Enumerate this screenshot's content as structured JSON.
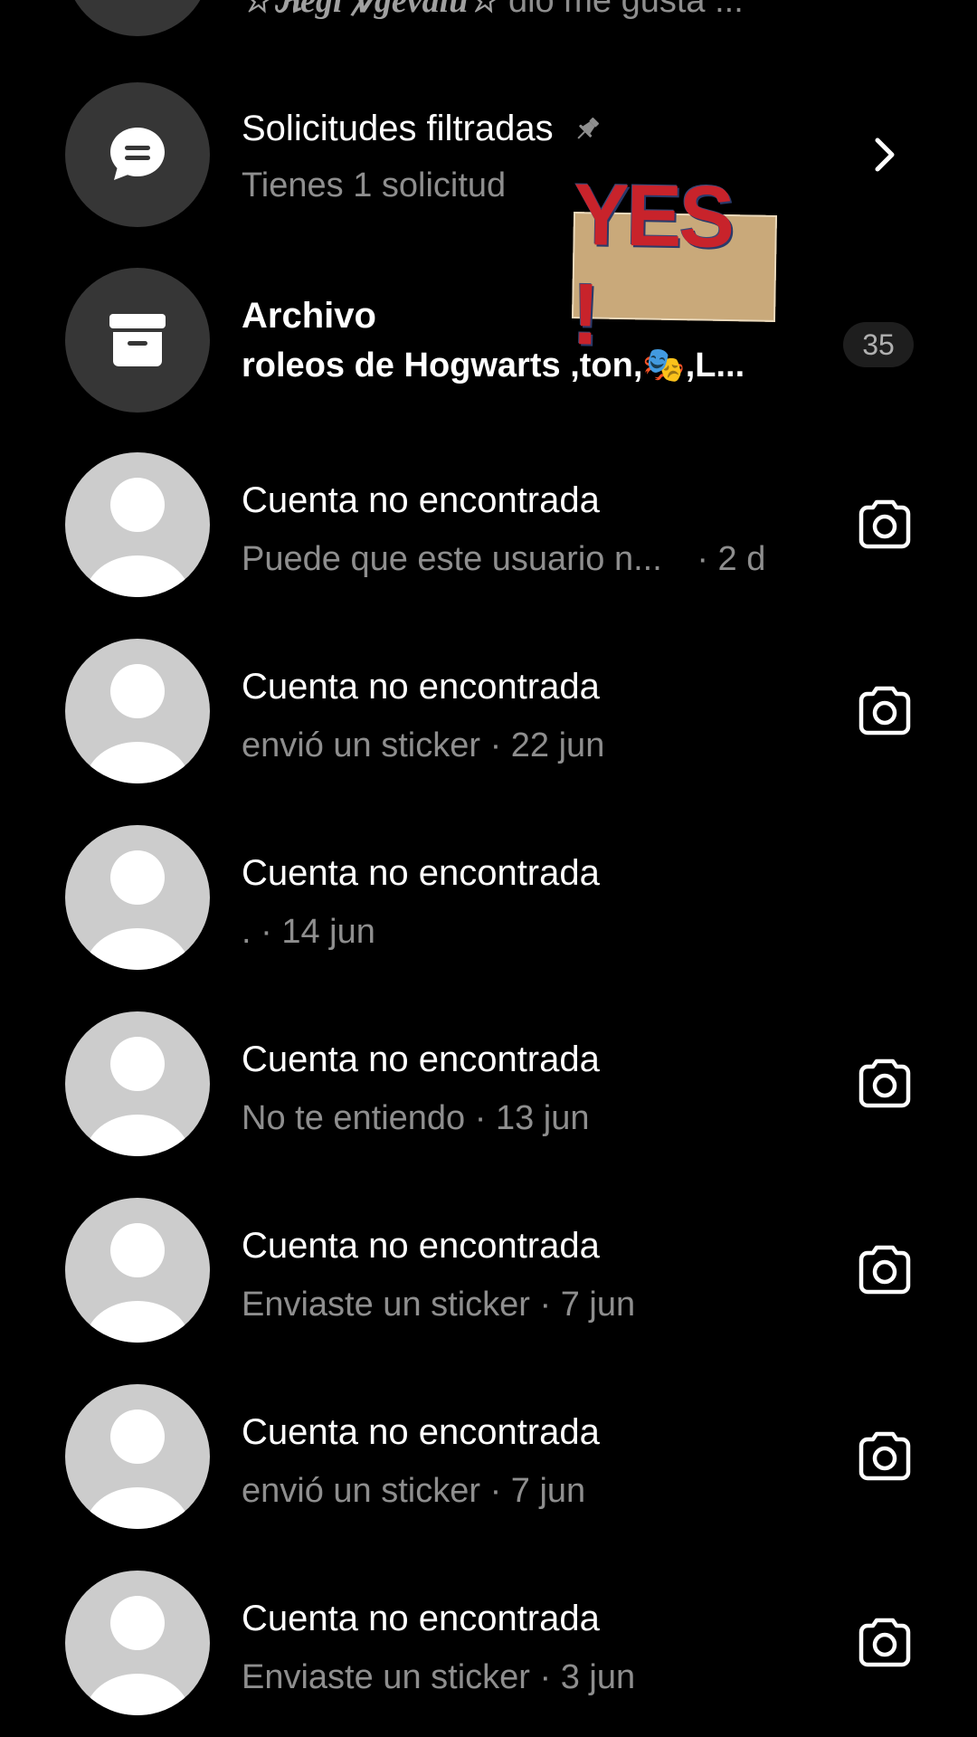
{
  "top_row": {
    "name": "☆ℜegi ℣gevaiu☆",
    "preview": "dio me gusta ..."
  },
  "filtered_requests": {
    "title": "Solicitudes filtradas",
    "subtitle": "Tienes 1 solicitud",
    "icon": "chat-bubble-icon",
    "pin_icon": "pin-icon",
    "chevron_icon": "chevron-right-icon"
  },
  "archive": {
    "title": "Archivo",
    "subtitle": "roleos de Hogwarts ,ton,🎭,L...",
    "badge": "35",
    "icon": "archive-box-icon"
  },
  "sticker": {
    "text": "YES !"
  },
  "conversations": [
    {
      "name": "Cuenta no encontrada",
      "preview": "Puede que este usuario n...",
      "time": "· 2 d",
      "camera": true
    },
    {
      "name": "Cuenta no encontrada",
      "preview": "envió un sticker",
      "time": "· 22 jun",
      "camera": true
    },
    {
      "name": "Cuenta no encontrada",
      "preview": ".",
      "time": "· 14 jun",
      "camera": false
    },
    {
      "name": "Cuenta no encontrada",
      "preview": "No te entiendo",
      "time": "· 13 jun",
      "camera": true
    },
    {
      "name": "Cuenta no encontrada",
      "preview": "Enviaste un sticker",
      "time": "· 7 jun",
      "camera": true
    },
    {
      "name": "Cuenta no encontrada",
      "preview": "envió un sticker",
      "time": "· 7 jun",
      "camera": true
    },
    {
      "name": "Cuenta no encontrada",
      "preview": "Enviaste un sticker",
      "time": "· 3 jun",
      "camera": true
    }
  ],
  "colors": {
    "background": "#000000",
    "secondary_text": "#8e8e8e",
    "avatar_placeholder": "#cccccc",
    "dark_circle": "#363636"
  }
}
